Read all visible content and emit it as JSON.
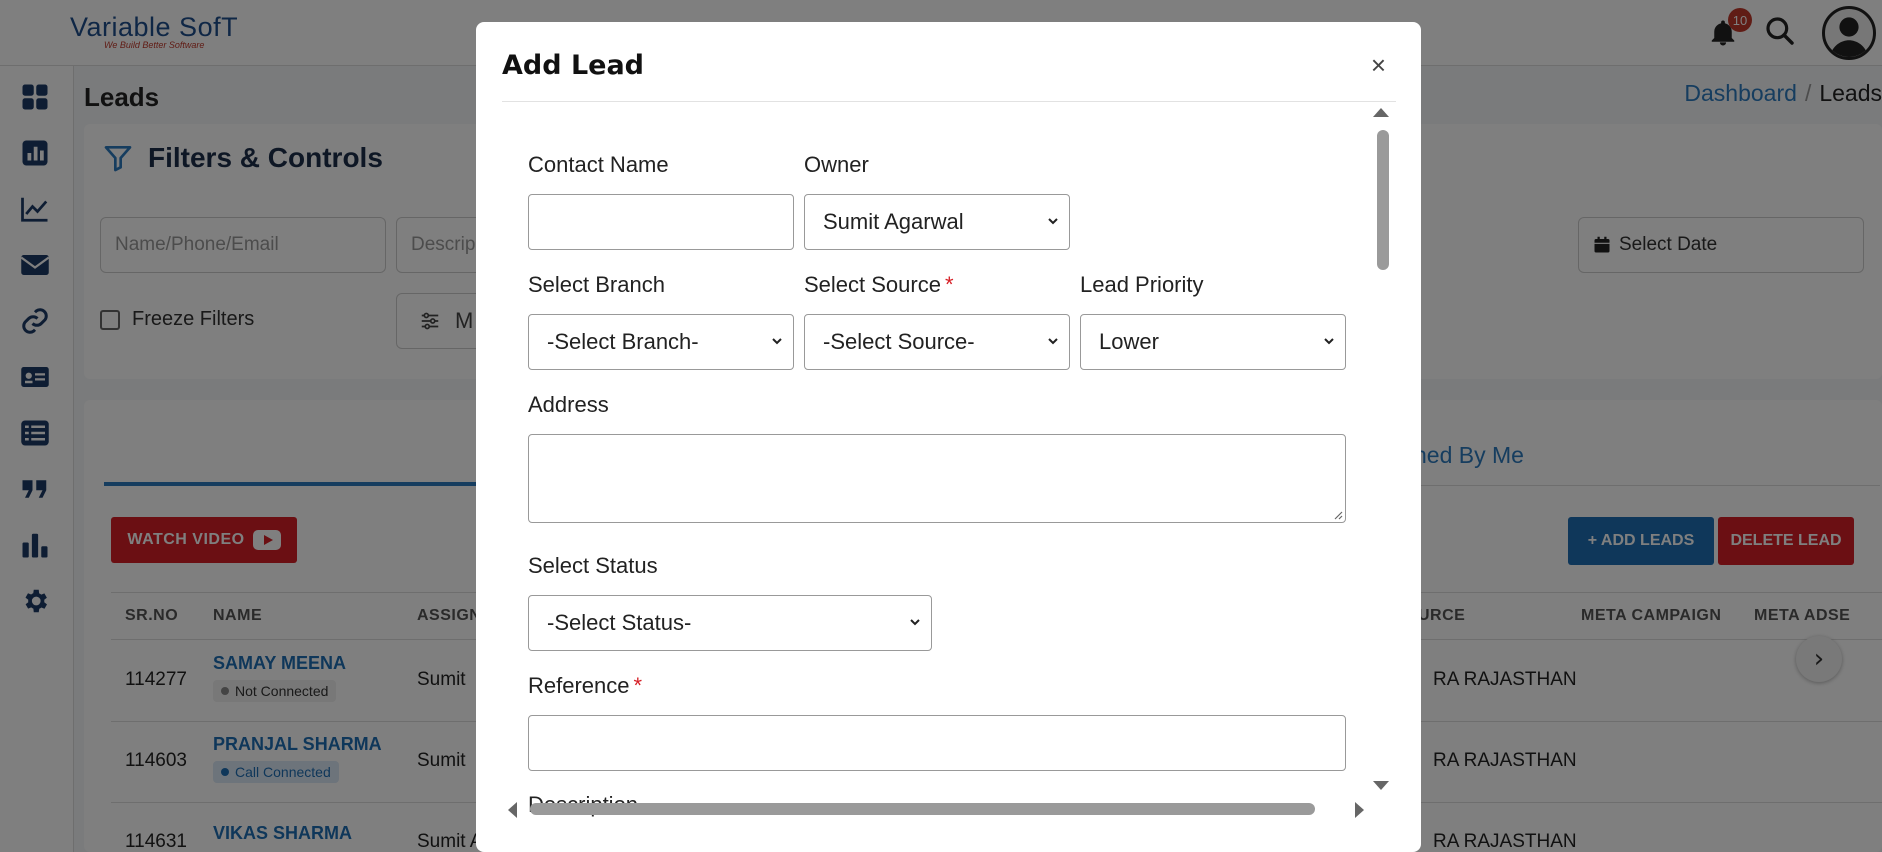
{
  "app": {
    "logo_text": "Variable SofT",
    "logo_tagline": "We Build Better Software",
    "notification_count": "10"
  },
  "sidebar": {
    "items": [
      {
        "icon": "dashboard-icon"
      },
      {
        "icon": "report-icon"
      },
      {
        "icon": "line-chart-icon"
      },
      {
        "icon": "mail-icon"
      },
      {
        "icon": "link-icon"
      },
      {
        "icon": "id-card-icon"
      },
      {
        "icon": "list-icon"
      },
      {
        "icon": "quote-icon"
      },
      {
        "icon": "bar-chart-icon"
      },
      {
        "icon": "gear-icon"
      }
    ]
  },
  "page": {
    "title": "Leads",
    "breadcrumb": {
      "home": "Dashboard",
      "separator": "/",
      "current": "Leads"
    }
  },
  "filters": {
    "title": "Filters & Controls",
    "name_placeholder": "Name/Phone/Email",
    "desc_placeholder": "Descrip",
    "freeze_label": "Freeze Filters",
    "more_label": "M",
    "date_label": "Select Date"
  },
  "leads": {
    "tab_right_label": "ned By Me",
    "watch_video_label": "WATCH VIDEO",
    "add_leads_label": "+ ADD LEADS",
    "delete_lead_label": "DELETE LEAD",
    "columns": {
      "srno": "SR.NO",
      "name": "NAME",
      "assign": "ASSIGN",
      "source": "URCE",
      "meta_campaign": "META CAMPAIGN",
      "meta_adset": "META ADSE"
    },
    "rows": [
      {
        "srno": "114277",
        "name": "SAMAY MEENA",
        "status": "Not Connected",
        "assign": "Sumit",
        "source": "RA RAJASTHAN"
      },
      {
        "srno": "114603",
        "name": "PRANJAL SHARMA",
        "status": "Call Connected",
        "assign": "Sumit",
        "source": "RA RAJASTHAN"
      },
      {
        "srno": "114631",
        "name": "VIKAS SHARMA",
        "status": "",
        "assign": "Sumit Agarwal",
        "source": "RA RAJASTHAN"
      }
    ]
  },
  "modal": {
    "title": "Add Lead",
    "close_symbol": "×",
    "fields": {
      "contact_name_label": "Contact Name",
      "contact_name_value": "",
      "owner_label": "Owner",
      "owner_value": "Sumit Agarwal",
      "branch_label": "Select Branch",
      "branch_value": "-Select Branch-",
      "source_label": "Select Source",
      "source_value": "-Select Source-",
      "priority_label": "Lead Priority",
      "priority_value": "Lower",
      "address_label": "Address",
      "address_value": "",
      "status_label": "Select Status",
      "status_value": "-Select Status-",
      "reference_label": "Reference",
      "reference_value": "",
      "description_label": "Description",
      "required_mark": "*"
    }
  }
}
